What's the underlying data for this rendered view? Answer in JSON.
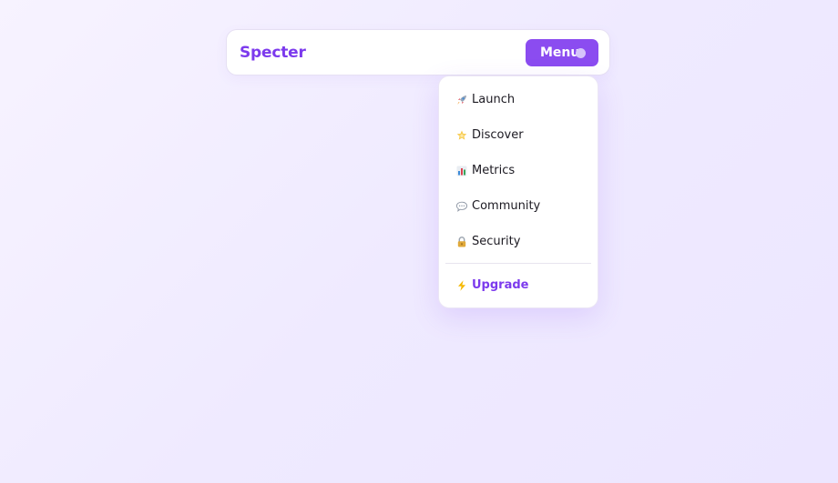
{
  "brand": {
    "name": "Specter"
  },
  "menu_button": {
    "label": "Menu"
  },
  "dropdown": {
    "items": [
      {
        "label": "Launch",
        "icon": "rocket-icon"
      },
      {
        "label": "Discover",
        "icon": "star-icon"
      },
      {
        "label": "Metrics",
        "icon": "bar-chart-icon"
      },
      {
        "label": "Community",
        "icon": "speech-bubble-icon"
      },
      {
        "label": "Security",
        "icon": "lock-icon"
      }
    ],
    "upgrade": {
      "label": "Upgrade",
      "icon": "lightning-icon"
    }
  },
  "colors": {
    "accent": "#7c3aed",
    "button": "#8b4cf0",
    "background": "#f2edff"
  }
}
